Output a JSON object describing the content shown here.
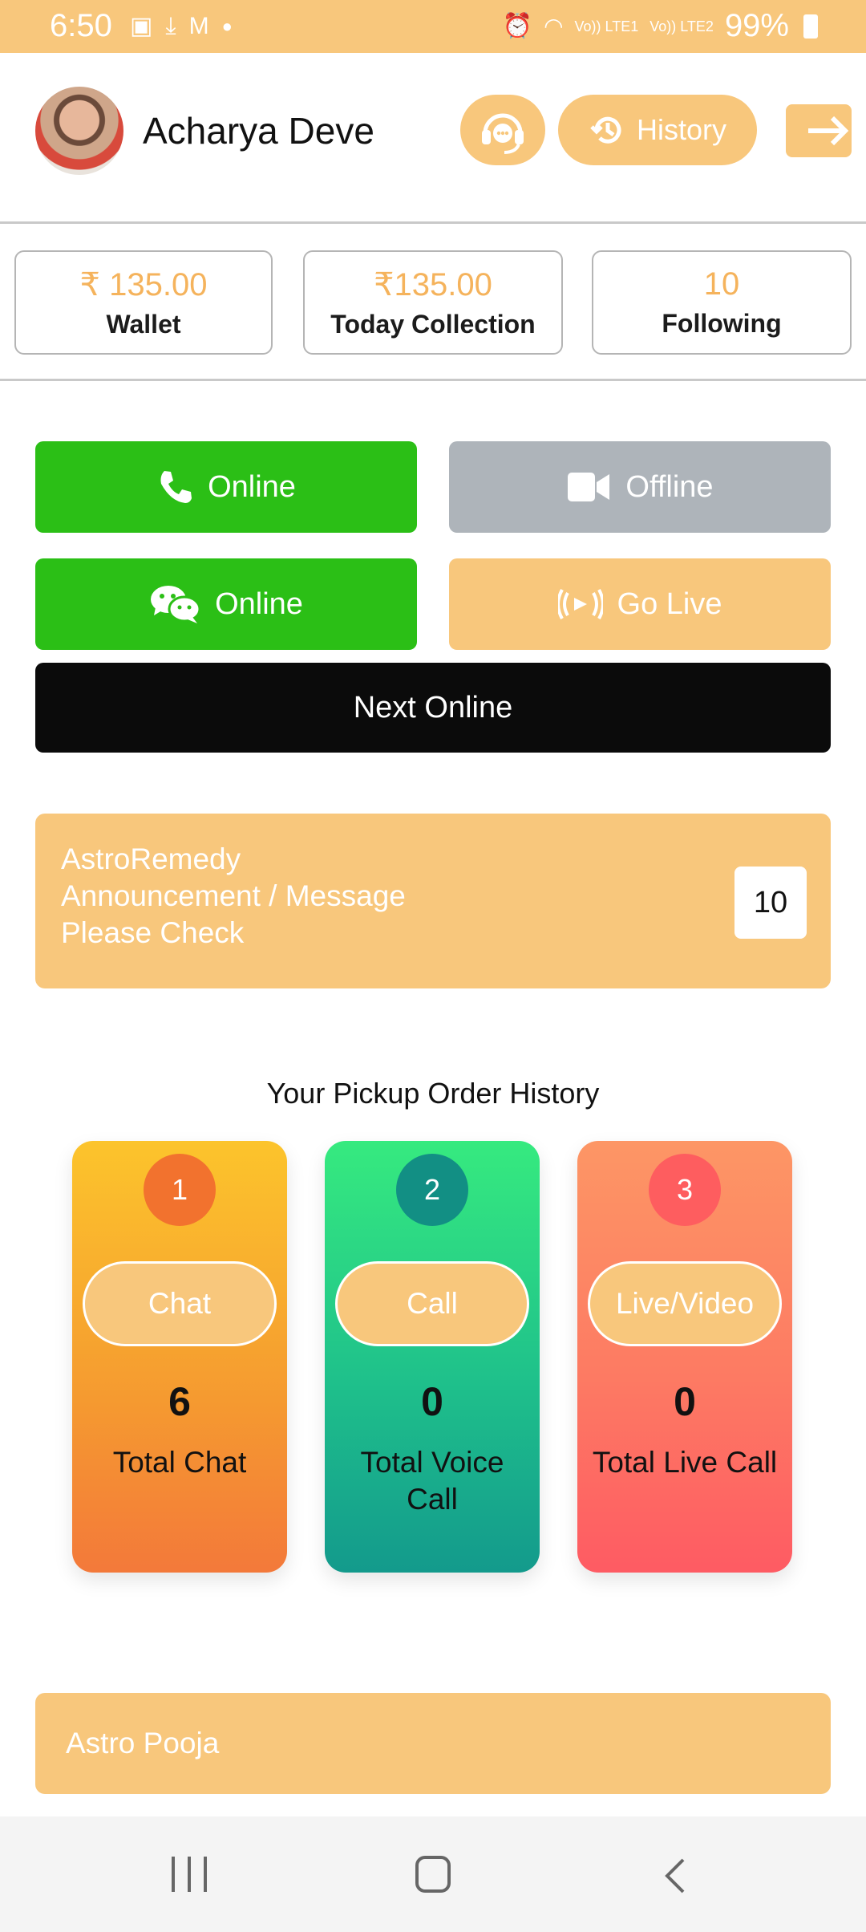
{
  "status_bar": {
    "time": "6:50",
    "signal1": "Vo)) LTE1",
    "signal2": "Vo)) LTE2",
    "battery": "99%"
  },
  "header": {
    "username": "Acharya Deve",
    "history_label": "History"
  },
  "stats": [
    {
      "value": "₹ 135.00",
      "label": "Wallet"
    },
    {
      "value": "₹135.00",
      "label": "Today Collection"
    },
    {
      "value": "10",
      "label": "Following"
    }
  ],
  "status_buttons": {
    "call": "Online",
    "video": "Offline",
    "chat": "Online",
    "live": "Go Live",
    "next": "Next Online"
  },
  "announcement": {
    "line1": "AstroRemedy",
    "line2": "Announcement / Message",
    "line3": "Please Check",
    "count": "10"
  },
  "order_history": {
    "title": "Your Pickup Order History",
    "cards": [
      {
        "num": "1",
        "label": "Chat",
        "count": "6",
        "desc": "Total Chat"
      },
      {
        "num": "2",
        "label": "Call",
        "count": "0",
        "desc": "Total Voice Call"
      },
      {
        "num": "3",
        "label": "Live/Video",
        "count": "0",
        "desc": "Total Live Call"
      }
    ]
  },
  "pooja": {
    "label": "Astro Pooja"
  },
  "colors": {
    "accent": "#f8c77c",
    "green": "#2bbf16",
    "gray": "#aeb4ba",
    "black": "#0b0b0b"
  }
}
